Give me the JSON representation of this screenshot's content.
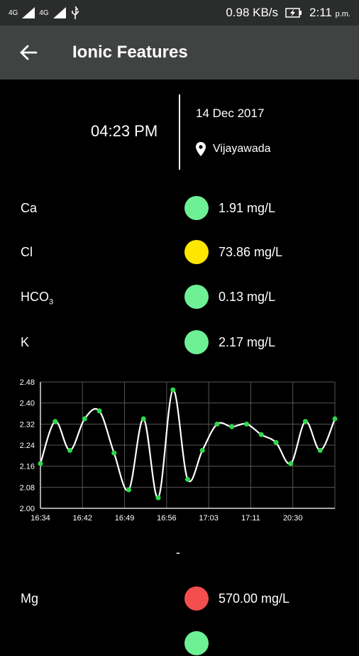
{
  "status_bar": {
    "network_labels": [
      "4G",
      "4G"
    ],
    "speed": "0.98 KB/s",
    "time": "2:11",
    "ampm": "p.m."
  },
  "app_bar": {
    "title": "Ionic Features"
  },
  "reading": {
    "time": "04:23 PM",
    "date": "14 Dec 2017",
    "location": "Vijayawada"
  },
  "ions": [
    {
      "name": "Ca",
      "value": "1.91 mg/L",
      "color": "#6ef094"
    },
    {
      "name": "Cl",
      "value": "73.86 mg/L",
      "color": "#ffe600"
    },
    {
      "name": "HCO",
      "sub": "3",
      "value": "0.13 mg/L",
      "color": "#6ef094"
    },
    {
      "name": "K",
      "value": "2.17 mg/L",
      "color": "#6ef094"
    }
  ],
  "chart_data": {
    "type": "line",
    "y_ticks": [
      "2.48",
      "2.40",
      "2.32",
      "2.24",
      "2.16",
      "2.08",
      "2.00"
    ],
    "ylim": [
      2.0,
      2.48
    ],
    "x_ticks": [
      "16:34",
      "16:42",
      "16:49",
      "16:56",
      "17:03",
      "17:11",
      "20:30"
    ],
    "series": [
      {
        "values": [
          2.17,
          2.33,
          2.22,
          2.34,
          2.37,
          2.21,
          2.07,
          2.34,
          2.04,
          2.45,
          2.11,
          2.22,
          2.32,
          2.31,
          2.32,
          2.28,
          2.25,
          2.17,
          2.33,
          2.22,
          2.34
        ]
      }
    ],
    "line_color": "#ffffff",
    "point_color": "#2ed94b",
    "grid": true
  },
  "separator": "-",
  "ions_lower": [
    {
      "name": "Mg",
      "value": "570.00 mg/L",
      "color": "#f44e4e"
    }
  ]
}
